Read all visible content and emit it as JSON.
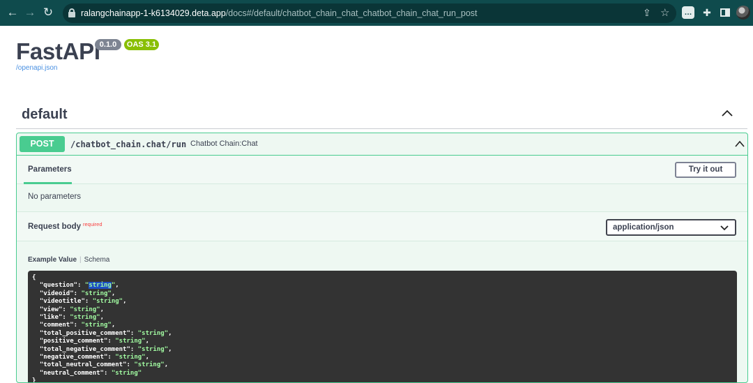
{
  "browser": {
    "url_host": "ralangchainapp-1-k6134029.deta.app",
    "url_path": "/docs#/default/chatbot_chain_chat_chatbot_chain_chat_run_post",
    "icons": {
      "back": "arrow-left-icon",
      "forward": "arrow-right-icon",
      "reload": "reload-icon",
      "lock": "lock-icon",
      "share": "share-icon",
      "bookmark": "star-icon",
      "chat_ext": "chat-extension-icon",
      "extensions": "puzzle-icon",
      "side_panel": "side-panel-icon",
      "profile": "avatar"
    }
  },
  "header": {
    "title": "FastAPI",
    "version_badge": "0.1.0",
    "oas_badge": "OAS 3.1",
    "openapi_link": "/openapi.json"
  },
  "section": {
    "title": "default"
  },
  "operation": {
    "method": "POST",
    "path": "/chatbot_chain.chat/run",
    "summary": "Chatbot Chain:Chat",
    "parameters_tab": "Parameters",
    "try_it_out": "Try it out",
    "no_parameters": "No parameters",
    "request_body_label": "Request body",
    "required_label": "required",
    "content_type": "application/json",
    "example_value_tab": "Example Value",
    "schema_tab": "Schema"
  },
  "example": {
    "open_brace": "{",
    "close_brace": "}",
    "fields": [
      {
        "key": "question",
        "value": "string"
      },
      {
        "key": "videoid",
        "value": "string"
      },
      {
        "key": "videotitle",
        "value": "string"
      },
      {
        "key": "view",
        "value": "string"
      },
      {
        "key": "like",
        "value": "string"
      },
      {
        "key": "comment",
        "value": "string"
      },
      {
        "key": "total_positive_comment",
        "value": "string"
      },
      {
        "key": "positive_comment",
        "value": "string"
      },
      {
        "key": "total_negative_comment",
        "value": "string"
      },
      {
        "key": "negative_comment",
        "value": "string"
      },
      {
        "key": "total_neutral_comment",
        "value": "string"
      },
      {
        "key": "neutral_comment",
        "value": "string"
      }
    ]
  },
  "colors": {
    "chrome_bg": "#0f4b4d",
    "post_green": "#49cc90",
    "code_bg": "#333333",
    "code_string": "#a2fca2",
    "required_red": "#f93e3e"
  }
}
